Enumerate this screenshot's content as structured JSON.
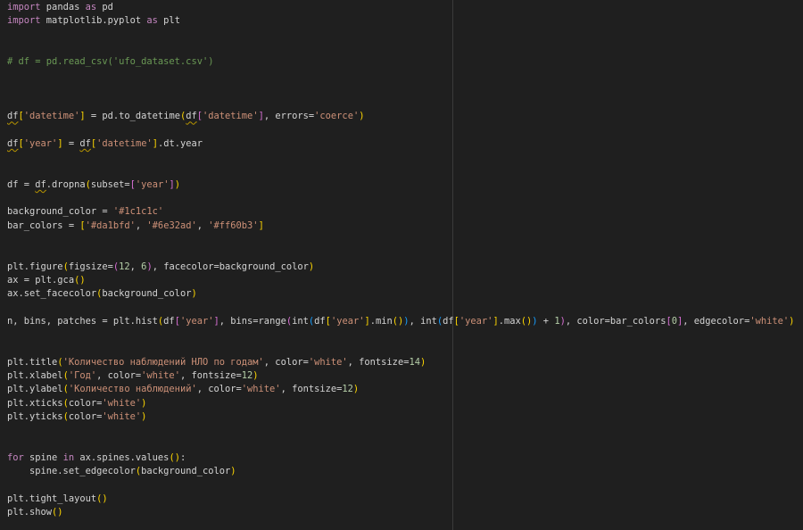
{
  "editor": {
    "lines": [
      [
        {
          "t": "import",
          "k": "kw"
        },
        {
          "t": " pandas "
        },
        {
          "t": "as",
          "k": "kw"
        },
        {
          "t": " pd"
        }
      ],
      [
        {
          "t": "import",
          "k": "kw"
        },
        {
          "t": " matplotlib.pyplot "
        },
        {
          "t": "as",
          "k": "kw"
        },
        {
          "t": " plt"
        }
      ],
      [],
      [],
      [
        {
          "t": "# df = pd.read_csv('ufo_dataset.csv')",
          "k": "cm"
        }
      ],
      [],
      [],
      [],
      [
        {
          "t": "df",
          "k": "sq"
        },
        {
          "t": "[",
          "k": "b1"
        },
        {
          "t": "'datetime'",
          "k": "st"
        },
        {
          "t": "]",
          "k": "b1"
        },
        {
          "t": " = pd.to_datetime"
        },
        {
          "t": "(",
          "k": "b1"
        },
        {
          "t": "df",
          "k": "sq"
        },
        {
          "t": "[",
          "k": "b2"
        },
        {
          "t": "'datetime'",
          "k": "st"
        },
        {
          "t": "]",
          "k": "b2"
        },
        {
          "t": ", errors="
        },
        {
          "t": "'coerce'",
          "k": "st"
        },
        {
          "t": ")",
          "k": "b1"
        }
      ],
      [],
      [
        {
          "t": "df",
          "k": "sq"
        },
        {
          "t": "[",
          "k": "b1"
        },
        {
          "t": "'year'",
          "k": "st"
        },
        {
          "t": "]",
          "k": "b1"
        },
        {
          "t": " = "
        },
        {
          "t": "df",
          "k": "sq"
        },
        {
          "t": "[",
          "k": "b1"
        },
        {
          "t": "'datetime'",
          "k": "st"
        },
        {
          "t": "]",
          "k": "b1"
        },
        {
          "t": ".dt.year"
        }
      ],
      [],
      [],
      [
        {
          "t": "df = "
        },
        {
          "t": "df",
          "k": "sq"
        },
        {
          "t": ".dropna"
        },
        {
          "t": "(",
          "k": "b1"
        },
        {
          "t": "subset="
        },
        {
          "t": "[",
          "k": "b2"
        },
        {
          "t": "'year'",
          "k": "st"
        },
        {
          "t": "]",
          "k": "b2"
        },
        {
          "t": ")",
          "k": "b1"
        }
      ],
      [],
      [
        {
          "t": "background_color = "
        },
        {
          "t": "'#1c1c1c'",
          "k": "st"
        }
      ],
      [
        {
          "t": "bar_colors = "
        },
        {
          "t": "[",
          "k": "b1"
        },
        {
          "t": "'#da1bfd'",
          "k": "st"
        },
        {
          "t": ", "
        },
        {
          "t": "'#6e32ad'",
          "k": "st"
        },
        {
          "t": ", "
        },
        {
          "t": "'#ff60b3'",
          "k": "st"
        },
        {
          "t": "]",
          "k": "b1"
        }
      ],
      [],
      [],
      [
        {
          "t": "plt.figure"
        },
        {
          "t": "(",
          "k": "b1"
        },
        {
          "t": "figsize="
        },
        {
          "t": "(",
          "k": "b2"
        },
        {
          "t": "12",
          "k": "nu"
        },
        {
          "t": ", "
        },
        {
          "t": "6",
          "k": "nu"
        },
        {
          "t": ")",
          "k": "b2"
        },
        {
          "t": ", facecolor=background_color"
        },
        {
          "t": ")",
          "k": "b1"
        }
      ],
      [
        {
          "t": "ax = plt.gca"
        },
        {
          "t": "()",
          "k": "b1"
        }
      ],
      [
        {
          "t": "ax.set_facecolor"
        },
        {
          "t": "(",
          "k": "b1"
        },
        {
          "t": "background_color"
        },
        {
          "t": ")",
          "k": "b1"
        }
      ],
      [],
      [
        {
          "t": "n, bins, patches = plt.hist"
        },
        {
          "t": "(",
          "k": "b1"
        },
        {
          "t": "df"
        },
        {
          "t": "[",
          "k": "b2"
        },
        {
          "t": "'year'",
          "k": "st"
        },
        {
          "t": "]",
          "k": "b2"
        },
        {
          "t": ", bins=range"
        },
        {
          "t": "(",
          "k": "b2"
        },
        {
          "t": "int"
        },
        {
          "t": "(",
          "k": "b3"
        },
        {
          "t": "df"
        },
        {
          "t": "[",
          "k": "b1"
        },
        {
          "t": "'year'",
          "k": "st"
        },
        {
          "t": "]",
          "k": "b1"
        },
        {
          "t": ".min"
        },
        {
          "t": "()",
          "k": "b1"
        },
        {
          "t": ")",
          "k": "b3"
        },
        {
          "t": ", "
        },
        {
          "t": "int"
        },
        {
          "t": "(",
          "k": "b3"
        },
        {
          "t": "df"
        },
        {
          "t": "[",
          "k": "b1"
        },
        {
          "t": "'year'",
          "k": "st"
        },
        {
          "t": "]",
          "k": "b1"
        },
        {
          "t": ".max"
        },
        {
          "t": "()",
          "k": "b1"
        },
        {
          "t": ")",
          "k": "b3"
        },
        {
          "t": " + "
        },
        {
          "t": "1",
          "k": "nu"
        },
        {
          "t": ")",
          "k": "b2"
        },
        {
          "t": ", color=bar_colors"
        },
        {
          "t": "[",
          "k": "b2"
        },
        {
          "t": "0",
          "k": "nu"
        },
        {
          "t": "]",
          "k": "b2"
        },
        {
          "t": ", edgecolor="
        },
        {
          "t": "'white'",
          "k": "st"
        },
        {
          "t": ")",
          "k": "b1"
        }
      ],
      [],
      [],
      [
        {
          "t": "plt.title"
        },
        {
          "t": "(",
          "k": "b1"
        },
        {
          "t": "'Количество наблюдений НЛО по годам'",
          "k": "st"
        },
        {
          "t": ", color="
        },
        {
          "t": "'white'",
          "k": "st"
        },
        {
          "t": ", fontsize="
        },
        {
          "t": "14",
          "k": "nu"
        },
        {
          "t": ")",
          "k": "b1"
        }
      ],
      [
        {
          "t": "plt.xlabel"
        },
        {
          "t": "(",
          "k": "b1"
        },
        {
          "t": "'Год'",
          "k": "st"
        },
        {
          "t": ", color="
        },
        {
          "t": "'white'",
          "k": "st"
        },
        {
          "t": ", fontsize="
        },
        {
          "t": "12",
          "k": "nu"
        },
        {
          "t": ")",
          "k": "b1"
        }
      ],
      [
        {
          "t": "plt.ylabel"
        },
        {
          "t": "(",
          "k": "b1"
        },
        {
          "t": "'Количество наблюдений'",
          "k": "st"
        },
        {
          "t": ", color="
        },
        {
          "t": "'white'",
          "k": "st"
        },
        {
          "t": ", fontsize="
        },
        {
          "t": "12",
          "k": "nu"
        },
        {
          "t": ")",
          "k": "b1"
        }
      ],
      [
        {
          "t": "plt.xticks"
        },
        {
          "t": "(",
          "k": "b1"
        },
        {
          "t": "color="
        },
        {
          "t": "'white'",
          "k": "st"
        },
        {
          "t": ")",
          "k": "b1"
        }
      ],
      [
        {
          "t": "plt.yticks"
        },
        {
          "t": "(",
          "k": "b1"
        },
        {
          "t": "color="
        },
        {
          "t": "'white'",
          "k": "st"
        },
        {
          "t": ")",
          "k": "b1"
        }
      ],
      [],
      [],
      [
        {
          "t": "for",
          "k": "kw"
        },
        {
          "t": " spine "
        },
        {
          "t": "in",
          "k": "kw"
        },
        {
          "t": " ax.spines.values"
        },
        {
          "t": "()",
          "k": "b1"
        },
        {
          "t": ":"
        }
      ],
      [
        {
          "t": "    spine.set_edgecolor"
        },
        {
          "t": "(",
          "k": "b1"
        },
        {
          "t": "background_color"
        },
        {
          "t": ")",
          "k": "b1"
        }
      ],
      [],
      [
        {
          "t": "plt.tight_layout"
        },
        {
          "t": "()",
          "k": "b1"
        }
      ],
      [
        {
          "t": "plt.show"
        },
        {
          "t": "()",
          "k": "b1"
        }
      ]
    ]
  }
}
